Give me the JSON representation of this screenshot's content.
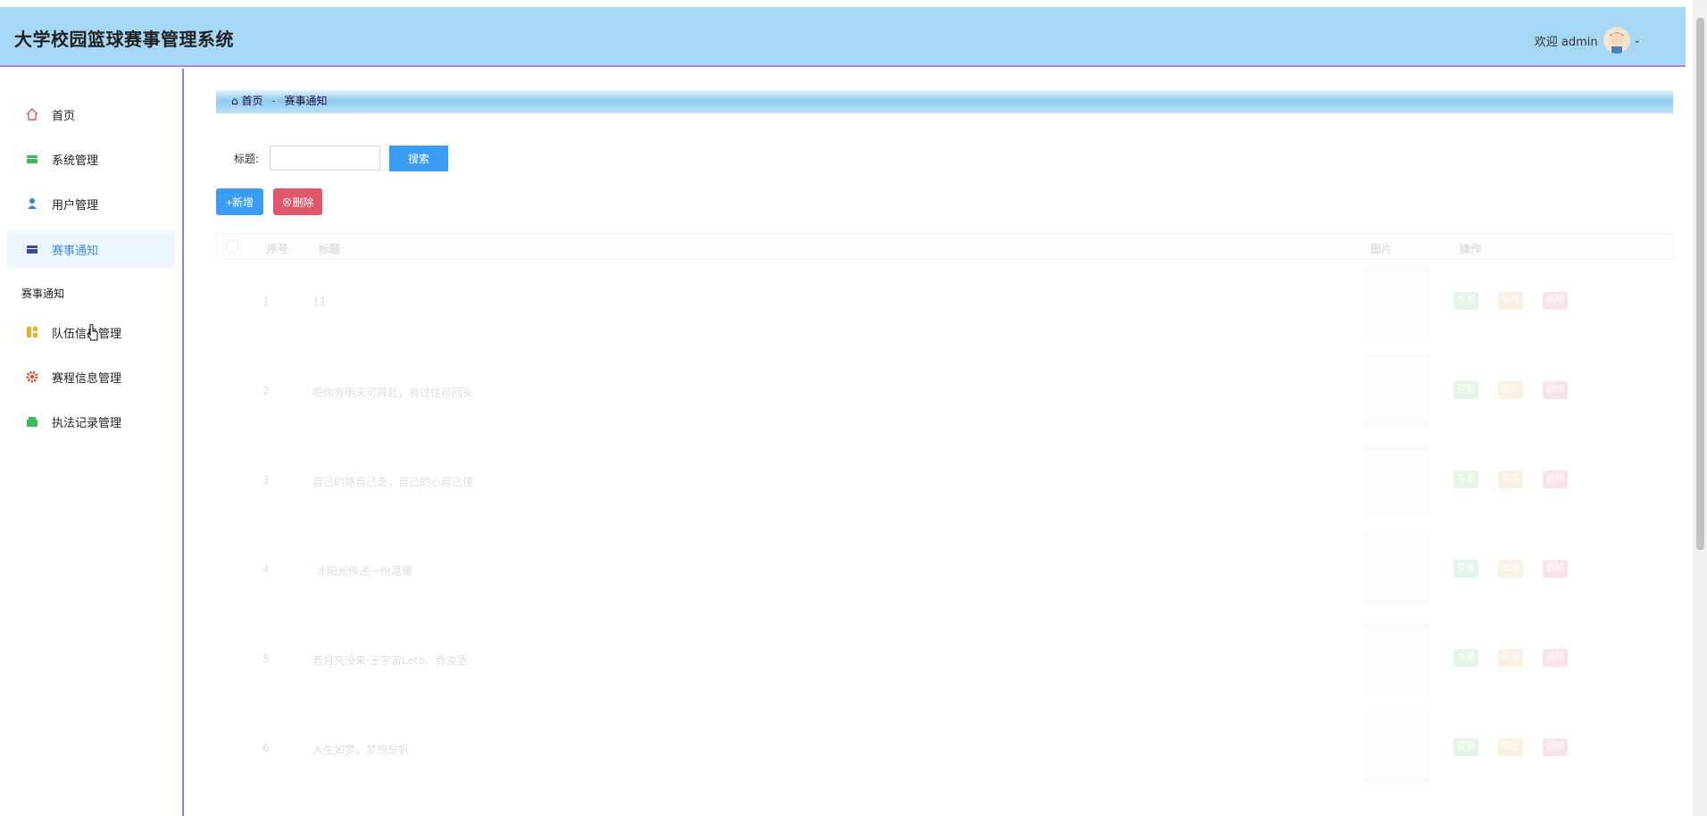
{
  "app": {
    "title": "大学校园篮球赛事管理系统"
  },
  "header": {
    "welcome": "欢迎 admin"
  },
  "sidebar": {
    "items": [
      {
        "label": "首页",
        "icon": "home-icon"
      },
      {
        "label": "系统管理",
        "icon": "system-icon"
      },
      {
        "label": "用户管理",
        "icon": "user-icon"
      },
      {
        "label": "赛事通知",
        "icon": "notice-icon"
      },
      {
        "label": "队伍信息管理",
        "icon": "team-icon"
      },
      {
        "label": "赛程信息管理",
        "icon": "schedule-icon"
      },
      {
        "label": "执法记录管理",
        "icon": "record-icon"
      }
    ],
    "sub_label": "赛事通知"
  },
  "breadcrumb": {
    "home": "首页",
    "sep": "-",
    "current": "赛事通知"
  },
  "search": {
    "label": "标题:",
    "value": "",
    "button": "搜索"
  },
  "toolbar": {
    "add": "新增",
    "delete": "删除"
  },
  "table": {
    "headers": {
      "index": "序号",
      "title": "标题",
      "image": "图片",
      "actions": "操作"
    },
    "rows": [
      {
        "index": "1",
        "title": "11"
      },
      {
        "index": "2",
        "title": "吧你有明天可再赴，有过往可回头"
      },
      {
        "index": "3",
        "title": "自己的路自己走，自己的心自己懂"
      },
      {
        "index": "4",
        "title": "·冰阳光传递一份温暖"
      },
      {
        "index": "5",
        "title": "若月亮没来·王宇宙Leto、乔浚丞"
      },
      {
        "index": "6",
        "title": "人生如梦，梦想是帆"
      }
    ],
    "action_labels": {
      "view": "查看",
      "edit": "修改",
      "delete": "删除"
    }
  },
  "colors": {
    "header_bg": "#a6d8f5",
    "primary": "#3b9cf4",
    "danger": "#e0576b",
    "success": "#5ac46a",
    "warning": "#e3ac48"
  }
}
